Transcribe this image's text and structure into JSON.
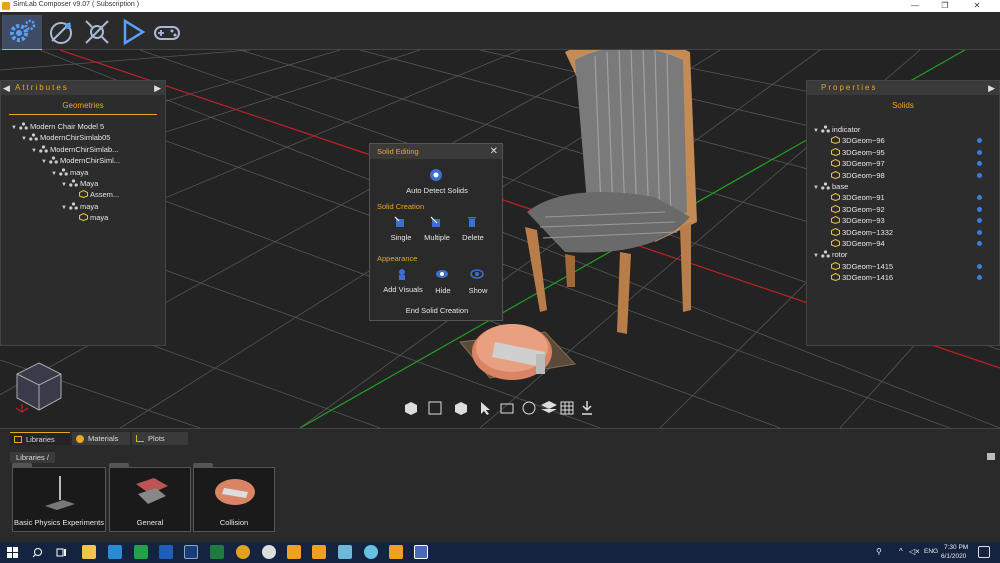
{
  "window": {
    "title": "SimLab Composer v9.07 ( Subscription )",
    "minimize": "—",
    "maximize": "❐",
    "close": "✕"
  },
  "toolbar": {
    "buttons": [
      "settings-icon",
      "scene-icon",
      "physics-icon",
      "play-icon",
      "gamepad-icon"
    ]
  },
  "attributes_panel": {
    "title": "Attributes",
    "section": "Geometries",
    "tree": [
      {
        "label": "Modern Chair Model 5",
        "depth": 0,
        "toggle": "▼"
      },
      {
        "label": "ModernChirSimlab05",
        "depth": 1,
        "toggle": "▼"
      },
      {
        "label": "ModernChirSimlab...",
        "depth": 2,
        "toggle": "▼"
      },
      {
        "label": "ModernChirSiml...",
        "depth": 3,
        "toggle": "▼"
      },
      {
        "label": "maya",
        "depth": 4,
        "toggle": "▼"
      },
      {
        "label": "Maya",
        "depth": 5,
        "toggle": "▼"
      },
      {
        "label": "Assem...",
        "depth": 6,
        "toggle": ""
      },
      {
        "label": "maya",
        "depth": 5,
        "toggle": "▼"
      },
      {
        "label": "maya",
        "depth": 6,
        "toggle": ""
      }
    ]
  },
  "properties_panel": {
    "title": "Properties",
    "section": "Solids",
    "tree": [
      {
        "label": "indicator",
        "depth": 0,
        "toggle": "▼",
        "dot": false
      },
      {
        "label": "3DGeom~96",
        "depth": 1,
        "toggle": "",
        "dot": true
      },
      {
        "label": "3DGeom~95",
        "depth": 1,
        "toggle": "",
        "dot": true
      },
      {
        "label": "3DGeom~97",
        "depth": 1,
        "toggle": "",
        "dot": true
      },
      {
        "label": "3DGeom~98",
        "depth": 1,
        "toggle": "",
        "dot": true
      },
      {
        "label": "base",
        "depth": 0,
        "toggle": "▼",
        "dot": false
      },
      {
        "label": "3DGeom~91",
        "depth": 1,
        "toggle": "",
        "dot": true
      },
      {
        "label": "3DGeom~92",
        "depth": 1,
        "toggle": "",
        "dot": true
      },
      {
        "label": "3DGeom~93",
        "depth": 1,
        "toggle": "",
        "dot": true
      },
      {
        "label": "3DGeom~1332",
        "depth": 1,
        "toggle": "",
        "dot": true
      },
      {
        "label": "3DGeom~94",
        "depth": 1,
        "toggle": "",
        "dot": true
      },
      {
        "label": "rotor",
        "depth": 0,
        "toggle": "▼",
        "dot": false
      },
      {
        "label": "3DGeom~1415",
        "depth": 1,
        "toggle": "",
        "dot": true
      },
      {
        "label": "3DGeom~1416",
        "depth": 1,
        "toggle": "",
        "dot": true
      }
    ]
  },
  "solid_editing": {
    "title": "Solid Editing",
    "close": "✕",
    "auto_detect": "Auto Detect Solids",
    "creation_section": "Solid Creation",
    "single": "Single",
    "multiple": "Multiple",
    "delete": "Delete",
    "appearance_section": "Appearance",
    "add_visuals": "Add Visuals",
    "hide": "Hide",
    "show": "Show",
    "end": "End Solid Creation"
  },
  "bottom_panel": {
    "tabs": [
      "Libraries",
      "Materials",
      "Plots"
    ],
    "breadcrumb": "Libraries  /",
    "cards": [
      "Basic Physics Experiments",
      "General",
      "Collision"
    ]
  },
  "taskbar": {
    "language": "ENG",
    "time": "7:30 PM",
    "date": "6/1/2020"
  },
  "colors": {
    "accent": "#e8a820",
    "dot_blue": "#3a7de0",
    "grid_red": "#c02020",
    "grid_green": "#20a020"
  }
}
